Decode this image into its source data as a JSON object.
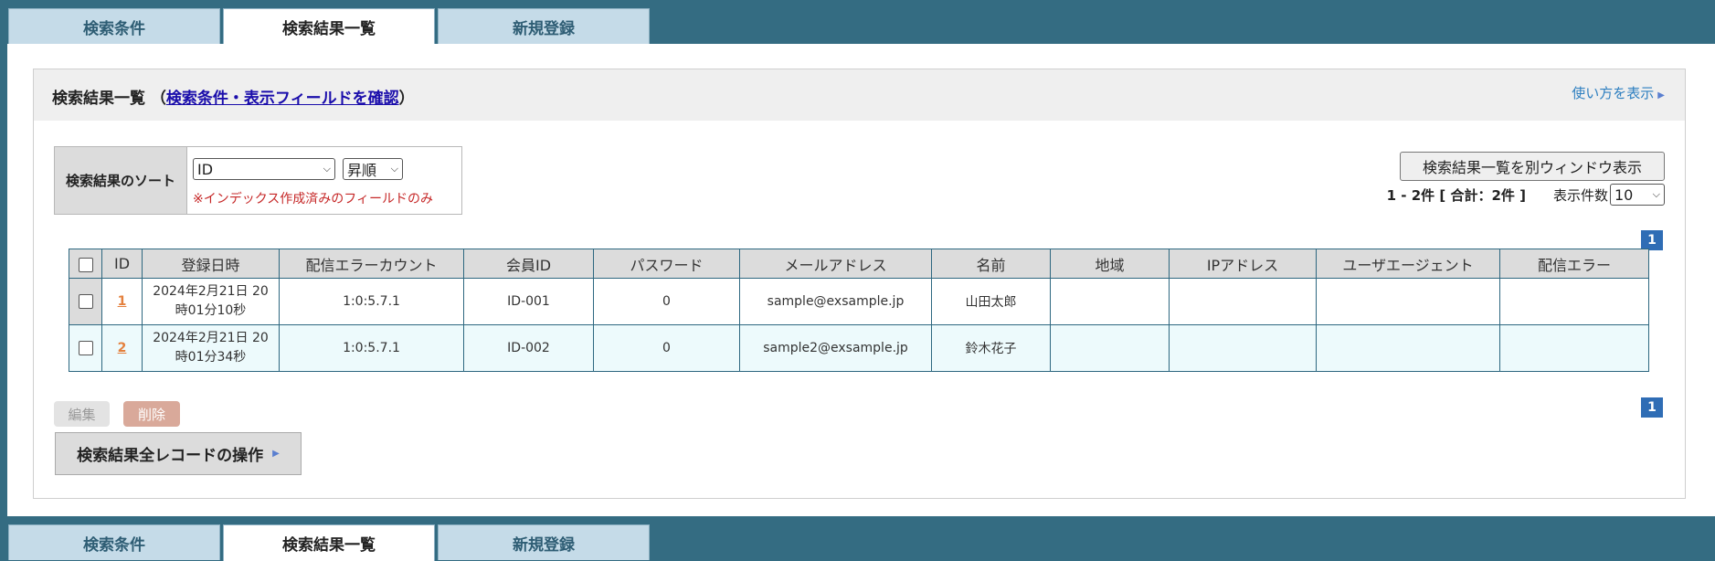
{
  "tabs": {
    "search_conditions": "検索条件",
    "search_results": "検索結果一覧",
    "new_registration": "新規登録"
  },
  "panel": {
    "title_prefix": "検索結果一覧 （",
    "title_link": "検索条件・表示フィールドを確認",
    "title_suffix": "）",
    "help_link": "使い方を表示"
  },
  "sort": {
    "label": "検索結果のソート",
    "field_selected": "ID",
    "order_selected": "昇順",
    "note": "※インデックス作成済みのフィールドのみ"
  },
  "toolbar": {
    "window_button": "検索結果一覧を別ウィンドウ表示",
    "count_text": "1 - 2件 [ 合計：2件 ]",
    "per_page_label": "表示件数",
    "per_page_value": "10",
    "page_number": "1"
  },
  "table": {
    "headers": [
      "ID",
      "登録日時",
      "配信エラーカウント",
      "会員ID",
      "パスワード",
      "メールアドレス",
      "名前",
      "地域",
      "IPアドレス",
      "ユーザエージェント",
      "配信エラー"
    ],
    "rows": [
      {
        "id": "1",
        "date_line1": "2024年2月21日 20",
        "date_line2": "時01分10秒",
        "error_count": "1:0:5.7.1",
        "member_id": "ID-001",
        "password": "0",
        "email": "sample@exsample.jp",
        "name": "山田太郎",
        "region": "",
        "ip": "",
        "user_agent": "",
        "delivery_error": ""
      },
      {
        "id": "2",
        "date_line1": "2024年2月21日 20",
        "date_line2": "時01分34秒",
        "error_count": "1:0:5.7.1",
        "member_id": "ID-002",
        "password": "0",
        "email": "sample2@exsample.jp",
        "name": "鈴木花子",
        "region": "",
        "ip": "",
        "user_agent": "",
        "delivery_error": ""
      }
    ]
  },
  "actions": {
    "edit": "編集",
    "delete": "削除",
    "all_records": "検索結果全レコードの操作"
  },
  "colors": {
    "frame": "#346c82",
    "tab_inactive": "#c5dbe8",
    "pager": "#2f6db5",
    "delete_button": "#d9a99a",
    "note_red": "#c62828"
  }
}
